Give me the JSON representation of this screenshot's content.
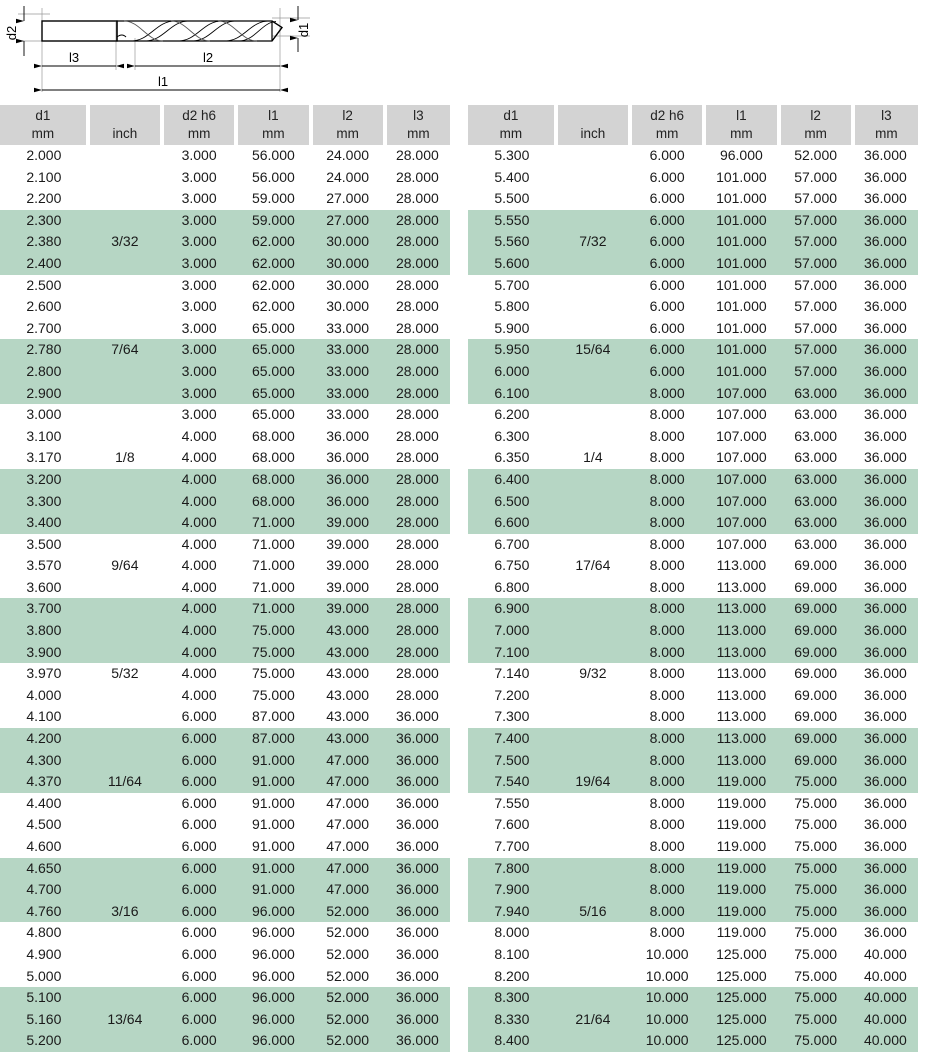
{
  "diagram": {
    "name": "drill-bit-dimension-drawing",
    "labels": {
      "d2": "d2",
      "d1": "d1",
      "l3": "l3",
      "l2": "l2",
      "l1": "l1"
    },
    "description": "Twist drill bit cross-section with dimension callouts"
  },
  "colors": {
    "header_background": "#d3d3d3",
    "row_highlight": "#b6d6c4",
    "row_default": "#ffffff",
    "text": "#1a1a1a"
  },
  "columns": [
    {
      "key": "d1",
      "symbol": "d1",
      "unit": "mm"
    },
    {
      "key": "inch",
      "symbol": "",
      "unit": "inch"
    },
    {
      "key": "d2",
      "symbol": "d2 h6",
      "unit": "mm"
    },
    {
      "key": "l1",
      "symbol": "l1",
      "unit": "mm"
    },
    {
      "key": "l2",
      "symbol": "l2",
      "unit": "mm"
    },
    {
      "key": "l3",
      "symbol": "l3",
      "unit": "mm"
    }
  ],
  "tables": [
    {
      "name": "left-table",
      "rows": [
        [
          "2.000",
          "",
          "3.000",
          "56.000",
          "24.000",
          "28.000"
        ],
        [
          "2.100",
          "",
          "3.000",
          "56.000",
          "24.000",
          "28.000"
        ],
        [
          "2.200",
          "",
          "3.000",
          "59.000",
          "27.000",
          "28.000"
        ],
        [
          "2.300",
          "",
          "3.000",
          "59.000",
          "27.000",
          "28.000"
        ],
        [
          "2.380",
          "3/32",
          "3.000",
          "62.000",
          "30.000",
          "28.000"
        ],
        [
          "2.400",
          "",
          "3.000",
          "62.000",
          "30.000",
          "28.000"
        ],
        [
          "2.500",
          "",
          "3.000",
          "62.000",
          "30.000",
          "28.000"
        ],
        [
          "2.600",
          "",
          "3.000",
          "62.000",
          "30.000",
          "28.000"
        ],
        [
          "2.700",
          "",
          "3.000",
          "65.000",
          "33.000",
          "28.000"
        ],
        [
          "2.780",
          "7/64",
          "3.000",
          "65.000",
          "33.000",
          "28.000"
        ],
        [
          "2.800",
          "",
          "3.000",
          "65.000",
          "33.000",
          "28.000"
        ],
        [
          "2.900",
          "",
          "3.000",
          "65.000",
          "33.000",
          "28.000"
        ],
        [
          "3.000",
          "",
          "3.000",
          "65.000",
          "33.000",
          "28.000"
        ],
        [
          "3.100",
          "",
          "4.000",
          "68.000",
          "36.000",
          "28.000"
        ],
        [
          "3.170",
          "1/8",
          "4.000",
          "68.000",
          "36.000",
          "28.000"
        ],
        [
          "3.200",
          "",
          "4.000",
          "68.000",
          "36.000",
          "28.000"
        ],
        [
          "3.300",
          "",
          "4.000",
          "68.000",
          "36.000",
          "28.000"
        ],
        [
          "3.400",
          "",
          "4.000",
          "71.000",
          "39.000",
          "28.000"
        ],
        [
          "3.500",
          "",
          "4.000",
          "71.000",
          "39.000",
          "28.000"
        ],
        [
          "3.570",
          "9/64",
          "4.000",
          "71.000",
          "39.000",
          "28.000"
        ],
        [
          "3.600",
          "",
          "4.000",
          "71.000",
          "39.000",
          "28.000"
        ],
        [
          "3.700",
          "",
          "4.000",
          "71.000",
          "39.000",
          "28.000"
        ],
        [
          "3.800",
          "",
          "4.000",
          "75.000",
          "43.000",
          "28.000"
        ],
        [
          "3.900",
          "",
          "4.000",
          "75.000",
          "43.000",
          "28.000"
        ],
        [
          "3.970",
          "5/32",
          "4.000",
          "75.000",
          "43.000",
          "28.000"
        ],
        [
          "4.000",
          "",
          "4.000",
          "75.000",
          "43.000",
          "28.000"
        ],
        [
          "4.100",
          "",
          "6.000",
          "87.000",
          "43.000",
          "36.000"
        ],
        [
          "4.200",
          "",
          "6.000",
          "87.000",
          "43.000",
          "36.000"
        ],
        [
          "4.300",
          "",
          "6.000",
          "91.000",
          "47.000",
          "36.000"
        ],
        [
          "4.370",
          "11/64",
          "6.000",
          "91.000",
          "47.000",
          "36.000"
        ],
        [
          "4.400",
          "",
          "6.000",
          "91.000",
          "47.000",
          "36.000"
        ],
        [
          "4.500",
          "",
          "6.000",
          "91.000",
          "47.000",
          "36.000"
        ],
        [
          "4.600",
          "",
          "6.000",
          "91.000",
          "47.000",
          "36.000"
        ],
        [
          "4.650",
          "",
          "6.000",
          "91.000",
          "47.000",
          "36.000"
        ],
        [
          "4.700",
          "",
          "6.000",
          "91.000",
          "47.000",
          "36.000"
        ],
        [
          "4.760",
          "3/16",
          "6.000",
          "96.000",
          "52.000",
          "36.000"
        ],
        [
          "4.800",
          "",
          "6.000",
          "96.000",
          "52.000",
          "36.000"
        ],
        [
          "4.900",
          "",
          "6.000",
          "96.000",
          "52.000",
          "36.000"
        ],
        [
          "5.000",
          "",
          "6.000",
          "96.000",
          "52.000",
          "36.000"
        ],
        [
          "5.100",
          "",
          "6.000",
          "96.000",
          "52.000",
          "36.000"
        ],
        [
          "5.160",
          "13/64",
          "6.000",
          "96.000",
          "52.000",
          "36.000"
        ],
        [
          "5.200",
          "",
          "6.000",
          "96.000",
          "52.000",
          "36.000"
        ]
      ]
    },
    {
      "name": "right-table",
      "rows": [
        [
          "5.300",
          "",
          "6.000",
          "96.000",
          "52.000",
          "36.000"
        ],
        [
          "5.400",
          "",
          "6.000",
          "101.000",
          "57.000",
          "36.000"
        ],
        [
          "5.500",
          "",
          "6.000",
          "101.000",
          "57.000",
          "36.000"
        ],
        [
          "5.550",
          "",
          "6.000",
          "101.000",
          "57.000",
          "36.000"
        ],
        [
          "5.560",
          "7/32",
          "6.000",
          "101.000",
          "57.000",
          "36.000"
        ],
        [
          "5.600",
          "",
          "6.000",
          "101.000",
          "57.000",
          "36.000"
        ],
        [
          "5.700",
          "",
          "6.000",
          "101.000",
          "57.000",
          "36.000"
        ],
        [
          "5.800",
          "",
          "6.000",
          "101.000",
          "57.000",
          "36.000"
        ],
        [
          "5.900",
          "",
          "6.000",
          "101.000",
          "57.000",
          "36.000"
        ],
        [
          "5.950",
          "15/64",
          "6.000",
          "101.000",
          "57.000",
          "36.000"
        ],
        [
          "6.000",
          "",
          "6.000",
          "101.000",
          "57.000",
          "36.000"
        ],
        [
          "6.100",
          "",
          "8.000",
          "107.000",
          "63.000",
          "36.000"
        ],
        [
          "6.200",
          "",
          "8.000",
          "107.000",
          "63.000",
          "36.000"
        ],
        [
          "6.300",
          "",
          "8.000",
          "107.000",
          "63.000",
          "36.000"
        ],
        [
          "6.350",
          "1/4",
          "8.000",
          "107.000",
          "63.000",
          "36.000"
        ],
        [
          "6.400",
          "",
          "8.000",
          "107.000",
          "63.000",
          "36.000"
        ],
        [
          "6.500",
          "",
          "8.000",
          "107.000",
          "63.000",
          "36.000"
        ],
        [
          "6.600",
          "",
          "8.000",
          "107.000",
          "63.000",
          "36.000"
        ],
        [
          "6.700",
          "",
          "8.000",
          "107.000",
          "63.000",
          "36.000"
        ],
        [
          "6.750",
          "17/64",
          "8.000",
          "113.000",
          "69.000",
          "36.000"
        ],
        [
          "6.800",
          "",
          "8.000",
          "113.000",
          "69.000",
          "36.000"
        ],
        [
          "6.900",
          "",
          "8.000",
          "113.000",
          "69.000",
          "36.000"
        ],
        [
          "7.000",
          "",
          "8.000",
          "113.000",
          "69.000",
          "36.000"
        ],
        [
          "7.100",
          "",
          "8.000",
          "113.000",
          "69.000",
          "36.000"
        ],
        [
          "7.140",
          "9/32",
          "8.000",
          "113.000",
          "69.000",
          "36.000"
        ],
        [
          "7.200",
          "",
          "8.000",
          "113.000",
          "69.000",
          "36.000"
        ],
        [
          "7.300",
          "",
          "8.000",
          "113.000",
          "69.000",
          "36.000"
        ],
        [
          "7.400",
          "",
          "8.000",
          "113.000",
          "69.000",
          "36.000"
        ],
        [
          "7.500",
          "",
          "8.000",
          "113.000",
          "69.000",
          "36.000"
        ],
        [
          "7.540",
          "19/64",
          "8.000",
          "119.000",
          "75.000",
          "36.000"
        ],
        [
          "7.550",
          "",
          "8.000",
          "119.000",
          "75.000",
          "36.000"
        ],
        [
          "7.600",
          "",
          "8.000",
          "119.000",
          "75.000",
          "36.000"
        ],
        [
          "7.700",
          "",
          "8.000",
          "119.000",
          "75.000",
          "36.000"
        ],
        [
          "7.800",
          "",
          "8.000",
          "119.000",
          "75.000",
          "36.000"
        ],
        [
          "7.900",
          "",
          "8.000",
          "119.000",
          "75.000",
          "36.000"
        ],
        [
          "7.940",
          "5/16",
          "8.000",
          "119.000",
          "75.000",
          "36.000"
        ],
        [
          "8.000",
          "",
          "8.000",
          "119.000",
          "75.000",
          "36.000"
        ],
        [
          "8.100",
          "",
          "10.000",
          "125.000",
          "75.000",
          "40.000"
        ],
        [
          "8.200",
          "",
          "10.000",
          "125.000",
          "75.000",
          "40.000"
        ],
        [
          "8.300",
          "",
          "10.000",
          "125.000",
          "75.000",
          "40.000"
        ],
        [
          "8.330",
          "21/64",
          "10.000",
          "125.000",
          "75.000",
          "40.000"
        ],
        [
          "8.400",
          "",
          "10.000",
          "125.000",
          "75.000",
          "40.000"
        ]
      ]
    }
  ]
}
